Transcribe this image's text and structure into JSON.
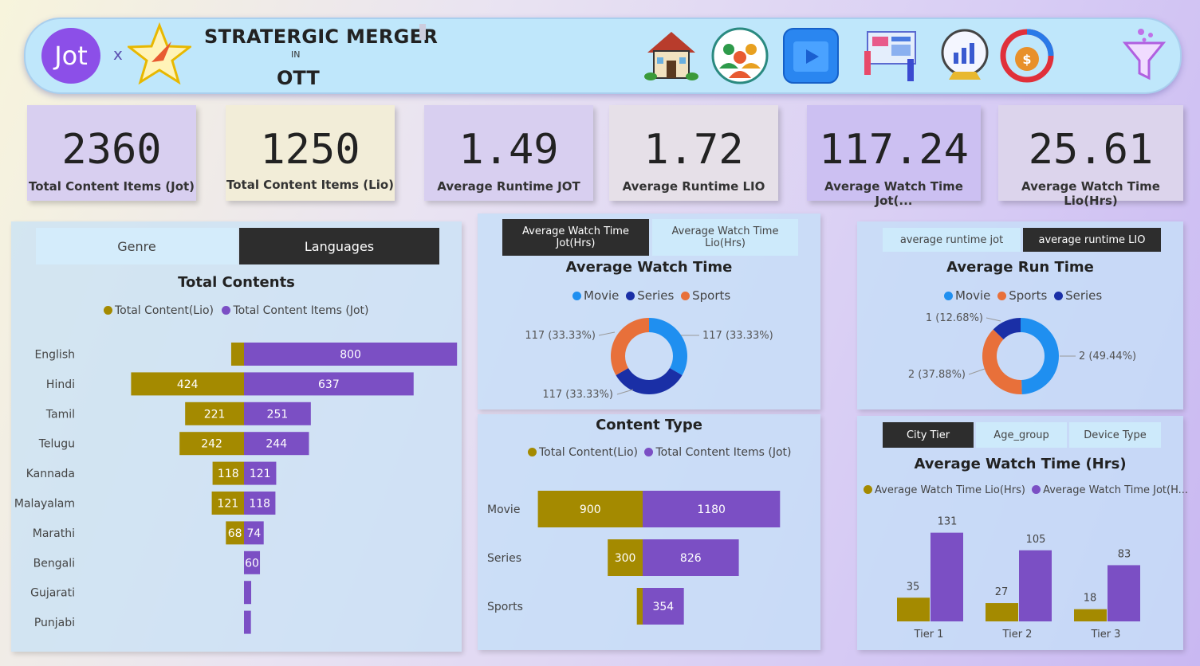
{
  "header": {
    "logo_text": "Jot",
    "x": "x",
    "title_line1": "STRATERGIC MERGER",
    "title_line2": "IN",
    "title_line3": "OTT",
    "icons": [
      "house-icon",
      "audience-icon",
      "video-icon",
      "analyst-icon",
      "crystal-ball-chart-icon",
      "money-cycle-icon",
      "filter-icon"
    ]
  },
  "kpis": [
    {
      "value": "2360",
      "label": "Total Content Items (Jot)"
    },
    {
      "value": "1250",
      "label": "Total Content Items (Lio)"
    },
    {
      "value": "1.49",
      "label": "Average Runtime JOT"
    },
    {
      "value": "1.72",
      "label": "Average Runtime LIO"
    },
    {
      "value": "117.24",
      "label": "Average Watch Time Jot(..."
    },
    {
      "value": "25.61",
      "label": "Average Watch Time Lio(Hrs)"
    }
  ],
  "left_panel": {
    "tabs": [
      "Genre",
      "Languages"
    ],
    "active_tab": "Languages"
  },
  "watch_panel": {
    "tabs": [
      "Average Watch Time Jot(Hrs)",
      "Average Watch Time Lio(Hrs)"
    ]
  },
  "runtime_panel": {
    "tabs": [
      "average runtime jot",
      "average runtime LIO"
    ]
  },
  "tier_panel": {
    "tabs": [
      "City Tier",
      "Age_group",
      "Device Type"
    ]
  },
  "colors": {
    "lio": "#a48a00",
    "jot": "#7b4fc4",
    "movie": "#1f8ff0",
    "series": "#1a2fa6",
    "sports": "#e8703a"
  },
  "chart_data": [
    {
      "type": "bar",
      "orientation": "horizontal-diverging",
      "title": "Total Contents",
      "legend": [
        "Total Content(Lio)",
        "Total Content Items (Jot)"
      ],
      "categories": [
        "English",
        "Hindi",
        "Tamil",
        "Telugu",
        "Kannada",
        "Malayalam",
        "Marathi",
        "Bengali",
        "Gujarati",
        "Punjabi"
      ],
      "series": [
        {
          "name": "Total Content(Lio)",
          "values": [
            48,
            424,
            221,
            242,
            118,
            121,
            68,
            0,
            0,
            0
          ]
        },
        {
          "name": "Total Content Items (Jot)",
          "values": [
            800,
            637,
            251,
            244,
            121,
            118,
            74,
            60,
            27,
            26
          ]
        }
      ],
      "data_labels_lio": [
        "",
        "424",
        "221",
        "242",
        "118",
        "121",
        "68",
        "",
        "",
        ""
      ],
      "data_labels_jot": [
        "800",
        "637",
        "251",
        "244",
        "121",
        "118",
        "74",
        "60",
        "",
        ""
      ]
    },
    {
      "type": "pie",
      "title": "Average Watch Time",
      "legend": [
        "Movie",
        "Series",
        "Sports"
      ],
      "slices": [
        {
          "name": "Movie",
          "value": 117,
          "label": "117 (33.33%)"
        },
        {
          "name": "Series",
          "value": 117,
          "label": "117 (33.33%)"
        },
        {
          "name": "Sports",
          "value": 117,
          "label": "117 (33.33%)"
        }
      ]
    },
    {
      "type": "pie",
      "title": "Average Run Time",
      "legend": [
        "Movie",
        "Sports",
        "Series"
      ],
      "slices": [
        {
          "name": "Movie",
          "value": 49.44,
          "label": "2 (49.44%)"
        },
        {
          "name": "Sports",
          "value": 37.88,
          "label": "2 (37.88%)"
        },
        {
          "name": "Series",
          "value": 12.68,
          "label": "1 (12.68%)"
        }
      ]
    },
    {
      "type": "bar",
      "orientation": "horizontal-diverging",
      "title": "Content Type",
      "legend": [
        "Total Content(Lio)",
        "Total Content Items (Jot)"
      ],
      "categories": [
        "Movie",
        "Series",
        "Sports"
      ],
      "series": [
        {
          "name": "Total Content(Lio)",
          "values": [
            900,
            300,
            50
          ]
        },
        {
          "name": "Total Content Items (Jot)",
          "values": [
            1180,
            826,
            354
          ]
        }
      ],
      "data_labels_lio": [
        "900",
        "300",
        ""
      ],
      "data_labels_jot": [
        "1180",
        "826",
        "354"
      ]
    },
    {
      "type": "bar",
      "title": "Average Watch Time (Hrs)",
      "legend": [
        "Average Watch Time Lio(Hrs)",
        "Average Watch Time Jot(H..."
      ],
      "categories": [
        "Tier 1",
        "Tier 2",
        "Tier 3"
      ],
      "series": [
        {
          "name": "Average Watch Time Lio(Hrs)",
          "values": [
            35,
            27,
            18
          ]
        },
        {
          "name": "Average Watch Time Jot(H...",
          "values": [
            131,
            105,
            83
          ]
        }
      ]
    }
  ]
}
